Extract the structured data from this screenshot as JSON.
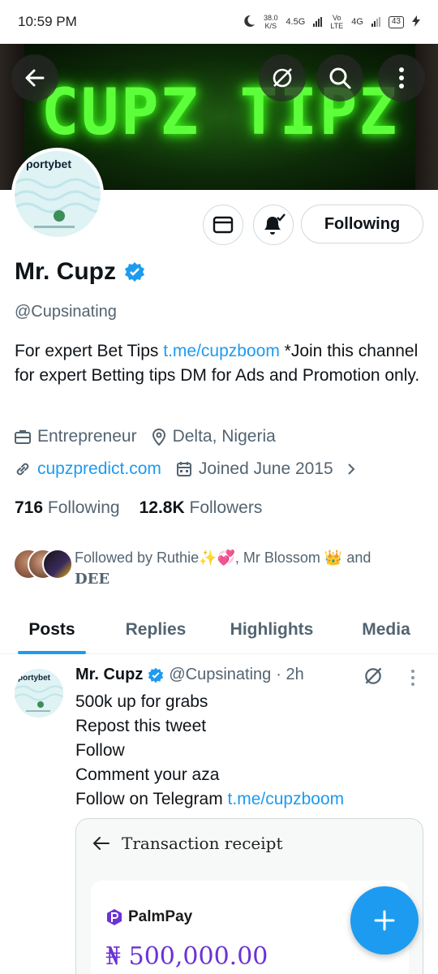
{
  "status_bar": {
    "time": "10:59 PM",
    "net_speed_value": "38.0",
    "net_speed_unit": "K/S",
    "network_1": "4.5G",
    "volte_top": "Vo",
    "volte_bottom": "LTE",
    "network_2": "4G",
    "battery": "43"
  },
  "banner": {
    "text": "CUPZ TIPZ"
  },
  "avatar": {
    "brand_text": "portybet"
  },
  "actions": {
    "following_label": "Following"
  },
  "profile": {
    "display_name": "Mr. Cupz",
    "handle": "@Cupsinating",
    "bio_prefix": "For expert Bet Tips ",
    "bio_link": "t.me/cupzboom",
    "bio_suffix": " *Join this channel for expert Betting tips DM for Ads and Promotion only.",
    "profession": "Entrepreneur",
    "location": "Delta, Nigeria",
    "website": "cupzpredict.com",
    "joined": "Joined June 2015",
    "following_count": "716",
    "following_label": "Following",
    "followers_count": "12.8K",
    "followers_label": "Followers"
  },
  "followed_by": {
    "text_prefix": "Followed by Ruthie✨💞, Mr Blossom 👑 and",
    "last_name": "DEE"
  },
  "tabs": [
    {
      "label": "Posts"
    },
    {
      "label": "Replies"
    },
    {
      "label": "Highlights"
    },
    {
      "label": "Media"
    }
  ],
  "post": {
    "author_name": "Mr. Cupz",
    "author_handle": "@Cupsinating",
    "time": "· 2h",
    "avatar_brand_text": "portybet",
    "lines": [
      "500k up for grabs",
      "Repost this tweet",
      "Follow",
      "Comment your aza"
    ],
    "last_line_prefix": "Follow on Telegram ",
    "last_line_link": "t.me/cupzboom",
    "receipt": {
      "title": "Transaction receipt",
      "brand": "PalmPay",
      "amount": "₦ 500,000.00"
    }
  },
  "colors": {
    "accent": "#1d9bf0",
    "banner_glow": "#5dff3a",
    "palmpay_purple": "#6b33d6"
  }
}
